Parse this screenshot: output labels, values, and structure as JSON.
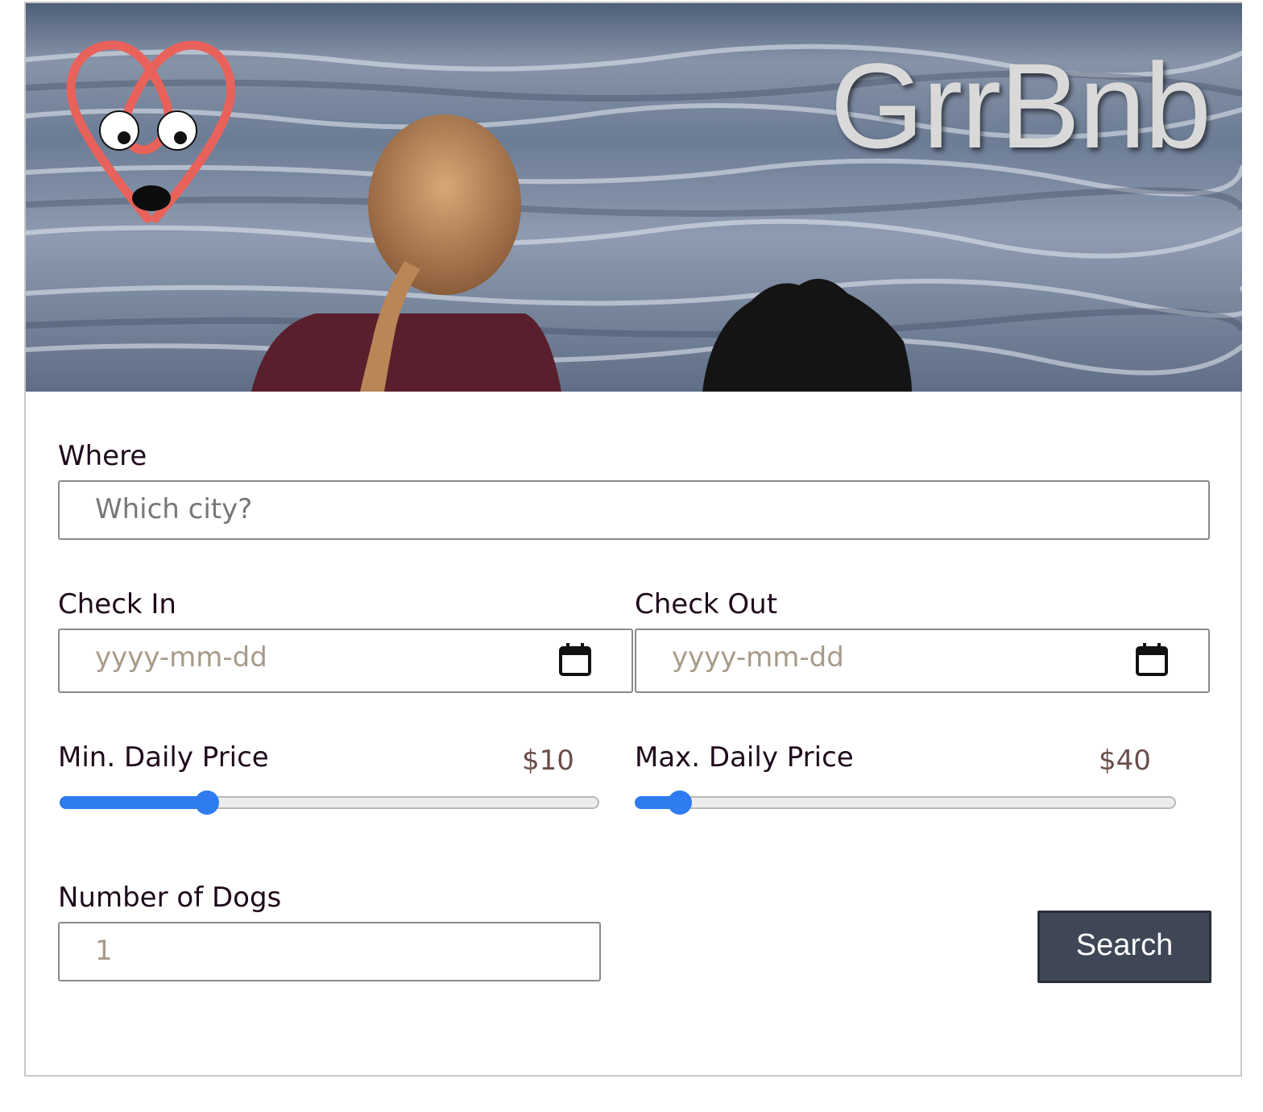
{
  "brand": {
    "name": "GrrBnb",
    "logo_icon": "dog-heart-logo-icon",
    "accent": "#e8625b"
  },
  "where": {
    "label": "Where",
    "placeholder": "Which city?"
  },
  "check_in": {
    "label": "Check In",
    "placeholder": "yyyy-mm-dd",
    "icon": "calendar-icon"
  },
  "check_out": {
    "label": "Check Out",
    "placeholder": "yyyy-mm-dd",
    "icon": "calendar-icon"
  },
  "min_price": {
    "label": "Min. Daily Price",
    "value_text": "$10",
    "slider_fraction": 0.27
  },
  "max_price": {
    "label": "Max. Daily Price",
    "value_text": "$40",
    "slider_fraction": 0.08
  },
  "dogs": {
    "label": "Number of Dogs",
    "value": "1"
  },
  "search_button": {
    "label": "Search"
  },
  "colors": {
    "slider_accent": "#2f7bf0",
    "button_bg": "#3f4656"
  }
}
